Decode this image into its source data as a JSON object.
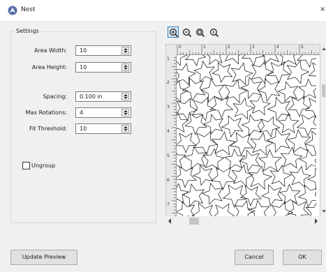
{
  "window": {
    "title": "Nest",
    "app_icon": "nest-app-icon",
    "close_glyph": "×"
  },
  "settings": {
    "group_title": "Settings",
    "fields": [
      {
        "label": "Area Width:",
        "value": "10"
      },
      {
        "label": "Area Height:",
        "value": "10"
      },
      {
        "label": "Spacing:",
        "value": "0.100 in"
      },
      {
        "label": "Max Rotations:",
        "value": "4"
      },
      {
        "label": "Fit Threshold:",
        "value": "10"
      }
    ],
    "ungroup": {
      "label": "Ungroup",
      "checked": false
    }
  },
  "toolbar": {
    "zoom_buttons": [
      {
        "name": "zoom-in-icon",
        "active": true
      },
      {
        "name": "zoom-out-icon",
        "active": false
      },
      {
        "name": "zoom-fit-icon",
        "active": false
      },
      {
        "name": "zoom-actual-icon",
        "active": false
      }
    ]
  },
  "preview": {
    "ruler_top_labels": [
      "0",
      "1",
      "2",
      "3",
      "4",
      "5"
    ],
    "ruler_left_labels": [
      "1",
      "2",
      "3",
      "4",
      "5",
      "6",
      "7"
    ],
    "shape": "star"
  },
  "buttons": {
    "update_preview": "Update Preview",
    "cancel": "Cancel",
    "ok": "OK"
  }
}
